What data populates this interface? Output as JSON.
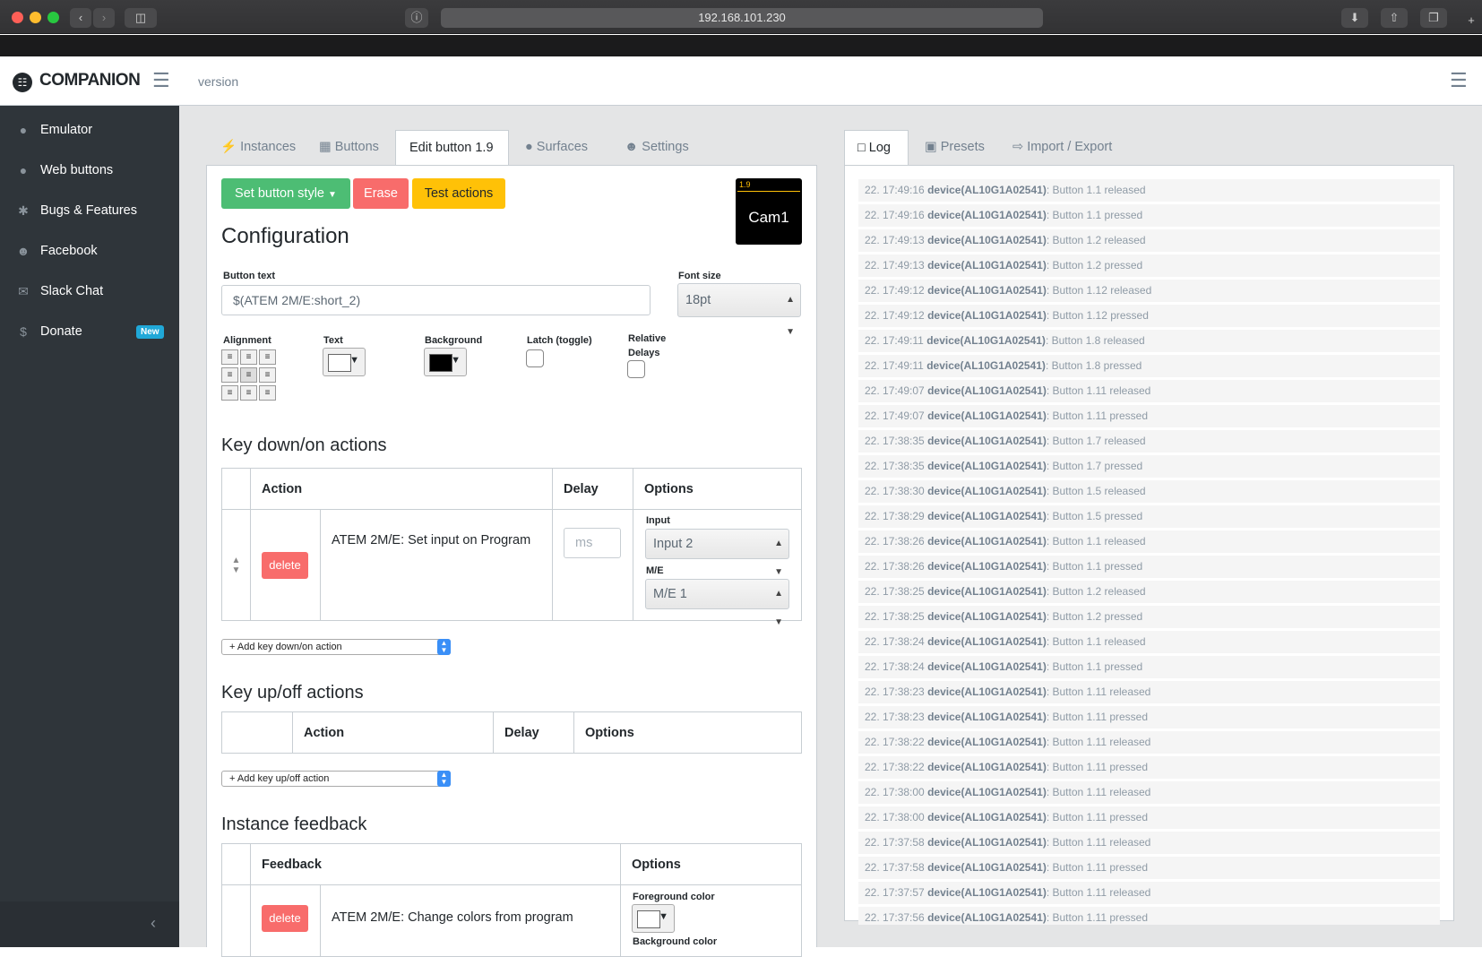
{
  "browser": {
    "url": "192.168.101.230"
  },
  "app": {
    "brand": "COMPANION",
    "version_label": "version"
  },
  "sidebar": {
    "items": [
      {
        "label": "Emulator",
        "icon": "gamepad-icon"
      },
      {
        "label": "Web buttons",
        "icon": "gamepad-icon"
      },
      {
        "label": "Bugs & Features",
        "icon": "bug-icon"
      },
      {
        "label": "Facebook",
        "icon": "users-icon"
      },
      {
        "label": "Slack Chat",
        "icon": "comments-icon"
      },
      {
        "label": "Donate",
        "icon": "dollar-icon",
        "badge": "New"
      }
    ]
  },
  "tabs_left": [
    {
      "label": "Instances",
      "icon": "plug-icon"
    },
    {
      "label": "Buttons",
      "icon": "grid-icon"
    },
    {
      "label": "Edit button 1.9",
      "active": true
    },
    {
      "label": "Surfaces",
      "icon": "gamepad-icon"
    },
    {
      "label": "Settings",
      "icon": "user-cog-icon"
    }
  ],
  "tabs_right": [
    {
      "label": "Log",
      "icon": "clipboard-icon",
      "active": true
    },
    {
      "label": "Presets",
      "icon": "gift-icon"
    },
    {
      "label": "Import / Export",
      "icon": "file-import-icon"
    }
  ],
  "toolbar": {
    "style_label": "Set button style",
    "erase_label": "Erase",
    "test_label": "Test actions"
  },
  "preview": {
    "id": "1.9",
    "text": "Cam1"
  },
  "config": {
    "title": "Configuration",
    "button_text_label": "Button text",
    "button_text_value": "$(ATEM 2M/E:short_2)",
    "font_size_label": "Font size",
    "font_size_value": "18pt",
    "alignment_label": "Alignment",
    "text_label": "Text",
    "background_label": "Background",
    "latch_label": "Latch (toggle)",
    "relative_label_1": "Relative",
    "relative_label_2": "Delays",
    "colors": {
      "text": "#ffffff",
      "background": "#000000"
    }
  },
  "keydown": {
    "title": "Key down/on actions",
    "headers": {
      "action": "Action",
      "delay": "Delay",
      "options": "Options"
    },
    "row": {
      "delete": "delete",
      "action": "ATEM 2M/E: Set input on Program",
      "delay_placeholder": "ms",
      "input_label": "Input",
      "input_value": "Input 2",
      "me_label": "M/E",
      "me_value": "M/E 1"
    },
    "add_label": "+ Add key down/on action"
  },
  "keyup": {
    "title": "Key up/off actions",
    "headers": {
      "action": "Action",
      "delay": "Delay",
      "options": "Options"
    },
    "add_label": "+ Add key up/off action"
  },
  "feedback": {
    "title": "Instance feedback",
    "headers": {
      "feedback": "Feedback",
      "options": "Options"
    },
    "row": {
      "delete": "delete",
      "feedback": "ATEM 2M/E: Change colors from program",
      "fg_label": "Foreground color",
      "bg_label": "Background color"
    }
  },
  "log": [
    {
      "time": "22. 17:49:16",
      "device": "device(AL10G1A02541)",
      "msg": ": Button 1.1 released"
    },
    {
      "time": "22. 17:49:16",
      "device": "device(AL10G1A02541)",
      "msg": ": Button 1.1 pressed"
    },
    {
      "time": "22. 17:49:13",
      "device": "device(AL10G1A02541)",
      "msg": ": Button 1.2 released"
    },
    {
      "time": "22. 17:49:13",
      "device": "device(AL10G1A02541)",
      "msg": ": Button 1.2 pressed"
    },
    {
      "time": "22. 17:49:12",
      "device": "device(AL10G1A02541)",
      "msg": ": Button 1.12 released"
    },
    {
      "time": "22. 17:49:12",
      "device": "device(AL10G1A02541)",
      "msg": ": Button 1.12 pressed"
    },
    {
      "time": "22. 17:49:11",
      "device": "device(AL10G1A02541)",
      "msg": ": Button 1.8 released"
    },
    {
      "time": "22. 17:49:11",
      "device": "device(AL10G1A02541)",
      "msg": ": Button 1.8 pressed"
    },
    {
      "time": "22. 17:49:07",
      "device": "device(AL10G1A02541)",
      "msg": ": Button 1.11 released"
    },
    {
      "time": "22. 17:49:07",
      "device": "device(AL10G1A02541)",
      "msg": ": Button 1.11 pressed"
    },
    {
      "time": "22. 17:38:35",
      "device": "device(AL10G1A02541)",
      "msg": ": Button 1.7 released"
    },
    {
      "time": "22. 17:38:35",
      "device": "device(AL10G1A02541)",
      "msg": ": Button 1.7 pressed"
    },
    {
      "time": "22. 17:38:30",
      "device": "device(AL10G1A02541)",
      "msg": ": Button 1.5 released"
    },
    {
      "time": "22. 17:38:29",
      "device": "device(AL10G1A02541)",
      "msg": ": Button 1.5 pressed"
    },
    {
      "time": "22. 17:38:26",
      "device": "device(AL10G1A02541)",
      "msg": ": Button 1.1 released"
    },
    {
      "time": "22. 17:38:26",
      "device": "device(AL10G1A02541)",
      "msg": ": Button 1.1 pressed"
    },
    {
      "time": "22. 17:38:25",
      "device": "device(AL10G1A02541)",
      "msg": ": Button 1.2 released"
    },
    {
      "time": "22. 17:38:25",
      "device": "device(AL10G1A02541)",
      "msg": ": Button 1.2 pressed"
    },
    {
      "time": "22. 17:38:24",
      "device": "device(AL10G1A02541)",
      "msg": ": Button 1.1 released"
    },
    {
      "time": "22. 17:38:24",
      "device": "device(AL10G1A02541)",
      "msg": ": Button 1.1 pressed"
    },
    {
      "time": "22. 17:38:23",
      "device": "device(AL10G1A02541)",
      "msg": ": Button 1.11 released"
    },
    {
      "time": "22. 17:38:23",
      "device": "device(AL10G1A02541)",
      "msg": ": Button 1.11 pressed"
    },
    {
      "time": "22. 17:38:22",
      "device": "device(AL10G1A02541)",
      "msg": ": Button 1.11 released"
    },
    {
      "time": "22. 17:38:22",
      "device": "device(AL10G1A02541)",
      "msg": ": Button 1.11 pressed"
    },
    {
      "time": "22. 17:38:00",
      "device": "device(AL10G1A02541)",
      "msg": ": Button 1.11 released"
    },
    {
      "time": "22. 17:38:00",
      "device": "device(AL10G1A02541)",
      "msg": ": Button 1.11 pressed"
    },
    {
      "time": "22. 17:37:58",
      "device": "device(AL10G1A02541)",
      "msg": ": Button 1.11 released"
    },
    {
      "time": "22. 17:37:58",
      "device": "device(AL10G1A02541)",
      "msg": ": Button 1.11 pressed"
    },
    {
      "time": "22. 17:37:57",
      "device": "device(AL10G1A02541)",
      "msg": ": Button 1.11 released"
    },
    {
      "time": "22. 17:37:56",
      "device": "device(AL10G1A02541)",
      "msg": ": Button 1.11 pressed"
    }
  ],
  "colors": {
    "accent_green": "#4dbd74",
    "accent_red": "#f86c6b",
    "accent_yellow": "#ffc107",
    "badge_blue": "#20a8d8",
    "sidebar_bg": "#2f353a"
  }
}
